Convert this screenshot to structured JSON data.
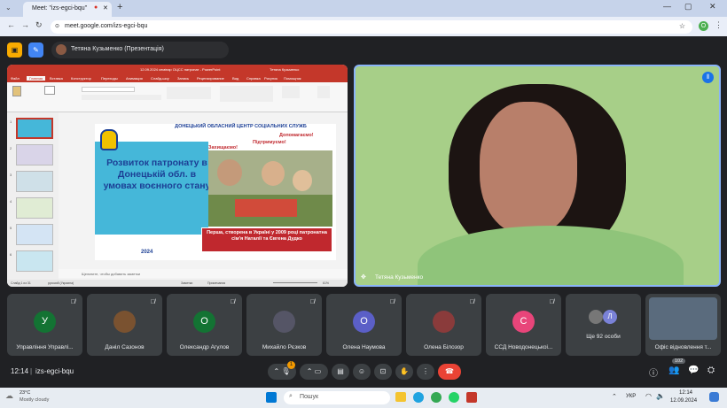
{
  "browser": {
    "tab_title": "Meet: \"izs-egci-bqu\"",
    "url": "meet.google.com/izs-egci-bqu",
    "profile_initial": "O"
  },
  "meet_header": {
    "presenter_label": "Тетяна Кузьменко (Презентація)"
  },
  "ppt": {
    "window_title": "12.09.2024 семінар ОЦСС патронат - PowerPoint",
    "user": "Тетяна Кузьменко",
    "tabs": [
      "Файл",
      "Главная",
      "Вставка",
      "Конструктор",
      "Переходы",
      "Анимация",
      "Слайд-шоу",
      "Запись",
      "Рецензирование",
      "Вид",
      "Справка",
      "Рисунок",
      "Помощник"
    ],
    "thumb_numbers": [
      "1",
      "2",
      "3",
      "4",
      "5",
      "6"
    ],
    "slide": {
      "header": "ДОНЕЦЬКИЙ ОБЛАСНИЙ ЦЕНТР СОЦІАЛЬНИХ СЛУЖБ",
      "tag1": "Допомагаємо!",
      "tag2": "Підтримуємо!",
      "tag3": "Захищаємо!",
      "title": "Розвиток патронату в Донецькій обл. в умовах воєнного стану",
      "caption": "Перша, створена в Україні у 2009 році патронатна сім'я Наталії та Євгена Дудко",
      "year": "2024"
    },
    "notes_placeholder": "Щелкните, чтобы добавить заметки",
    "status_slide": "Слайд 1 из 31",
    "status_lang": "русский (Украина)",
    "status_notes": "Заметки",
    "status_comments": "Примечания",
    "status_zoom": "61%"
  },
  "main_video": {
    "name": "Тетяна Кузьменко"
  },
  "tiles": [
    {
      "initial": "У",
      "color": "#137333",
      "name": "Управління Управлі..."
    },
    {
      "initial": "",
      "color": "#7a5230",
      "name": "Даніл Сазонов"
    },
    {
      "initial": "О",
      "color": "#137333",
      "name": "Олександр Агулов"
    },
    {
      "initial": "",
      "color": "#556",
      "name": "Михайло Рєзков"
    },
    {
      "initial": "О",
      "color": "#5b5fc7",
      "name": "Олена Наумова"
    },
    {
      "initial": "",
      "color": "#8a3b3b",
      "name": "Олена Білозор"
    },
    {
      "initial": "С",
      "color": "#e8457a",
      "name": "ССД Новодонецькоі..."
    },
    {
      "initial": "Л",
      "color": "#7a82d8",
      "name": "Ще 92 особи"
    },
    {
      "initial": "",
      "color": "#5a6b7d",
      "name": "Офіс відновлення т..."
    }
  ],
  "bottom": {
    "time": "12:14",
    "meeting_code": "izs-egci-bqu",
    "participants_count": "102",
    "raise_badge": "1"
  },
  "taskbar": {
    "weather_temp": "23°C",
    "weather_desc": "Mostly cloudy",
    "search": "Пошук",
    "lang": "УКР",
    "clock_time": "12:14",
    "clock_date": "12.09.2024"
  }
}
